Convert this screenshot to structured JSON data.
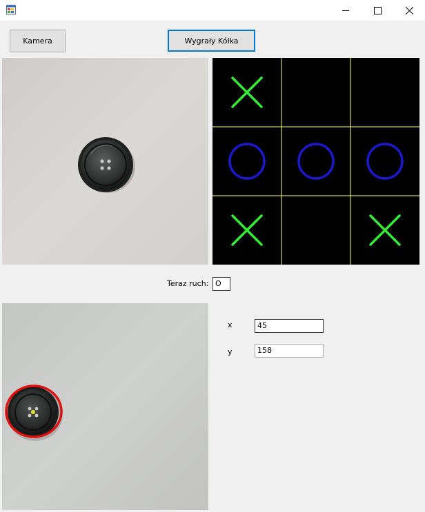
{
  "window": {
    "title": ""
  },
  "icons": {
    "app": "windows-form-icon",
    "minimize": "minimize-icon",
    "maximize": "maximize-icon",
    "close": "close-icon"
  },
  "toolbar": {
    "camera_label": "Kamera",
    "winner_label": "Wygrały Kółka"
  },
  "board": {
    "grid_color": "#ffff66",
    "x_color": "#33ee33",
    "o_color": "#1a1acc",
    "cells": [
      "X",
      "",
      "",
      "O",
      "O",
      "O",
      "X",
      "",
      "X"
    ]
  },
  "turn": {
    "label": "Teraz ruch:",
    "value": "O"
  },
  "coords": {
    "x_label": "x",
    "x_value": "45",
    "y_label": "y",
    "y_value": "158"
  },
  "detection": {
    "highlight_color": "#e01010"
  }
}
